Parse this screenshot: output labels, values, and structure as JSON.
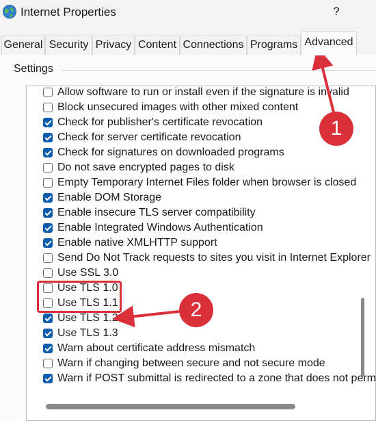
{
  "window": {
    "title": "Internet Properties",
    "help_label": "?"
  },
  "tabs": [
    {
      "label": "General"
    },
    {
      "label": "Security"
    },
    {
      "label": "Privacy"
    },
    {
      "label": "Content"
    },
    {
      "label": "Connections"
    },
    {
      "label": "Programs"
    },
    {
      "label": "Advanced",
      "active": true
    }
  ],
  "settings": {
    "group_label": "Settings",
    "items": [
      {
        "label": "Allow software to run or install even if the signature is invalid",
        "checked": false
      },
      {
        "label": "Block unsecured images with other mixed content",
        "checked": false
      },
      {
        "label": "Check for publisher's certificate revocation",
        "checked": true
      },
      {
        "label": "Check for server certificate revocation",
        "checked": true
      },
      {
        "label": "Check for signatures on downloaded programs",
        "checked": true
      },
      {
        "label": "Do not save encrypted pages to disk",
        "checked": false
      },
      {
        "label": "Empty Temporary Internet Files folder when browser is closed",
        "checked": false
      },
      {
        "label": "Enable DOM Storage",
        "checked": true
      },
      {
        "label": "Enable insecure TLS server compatibility",
        "checked": true
      },
      {
        "label": "Enable Integrated Windows Authentication",
        "checked": true
      },
      {
        "label": "Enable native XMLHTTP support",
        "checked": true
      },
      {
        "label": "Send Do Not Track requests to sites you visit in Internet Explorer",
        "checked": false
      },
      {
        "label": "Use SSL 3.0",
        "checked": false
      },
      {
        "label": "Use TLS 1.0",
        "checked": false
      },
      {
        "label": "Use TLS 1.1",
        "checked": false
      },
      {
        "label": "Use TLS 1.2",
        "checked": true
      },
      {
        "label": "Use TLS 1.3",
        "checked": true
      },
      {
        "label": "Warn about certificate address mismatch",
        "checked": true
      },
      {
        "label": "Warn if changing between secure and not secure mode",
        "checked": false
      },
      {
        "label": "Warn if POST submittal is redirected to a zone that does not permit posts",
        "checked": true
      }
    ]
  },
  "annotations": {
    "badge_1": "1",
    "badge_2": "2",
    "color": "#d9303a"
  },
  "colors": {
    "checkbox_checked": "#0b5cad"
  }
}
